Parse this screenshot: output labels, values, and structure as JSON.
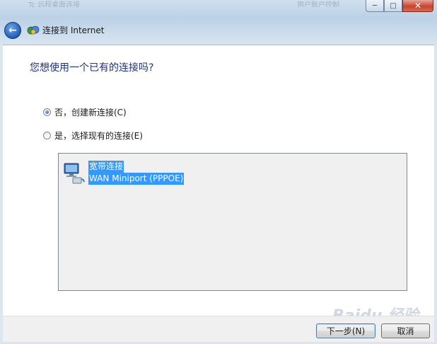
{
  "window": {
    "title": "连接到 Internet",
    "ghost_tab_1": "Tc 远程桌面连接",
    "ghost_tab_2": "用户账户控制",
    "minimize_label": "─",
    "maximize_label": "□",
    "close_label": "✕"
  },
  "nav": {
    "back_label": "←"
  },
  "main": {
    "question": "您想使用一个已有的连接吗?",
    "options": [
      {
        "label": "否，创建新连接(C)",
        "checked": true
      },
      {
        "label": "是，选择现有的连接(E)",
        "checked": false
      }
    ],
    "connections": [
      {
        "name": "宽带连接",
        "device": "WAN Miniport (PPPOE)",
        "icon": "network-adapter-icon",
        "selected": true
      }
    ]
  },
  "footer": {
    "next_label": "下一步(N)",
    "cancel_label": "取消"
  },
  "watermark": "Baidu 经验",
  "colors": {
    "question": "#1e3287",
    "selection": "#3399ff",
    "titlebar": "#bcd1e6",
    "close": "#c7452f"
  }
}
